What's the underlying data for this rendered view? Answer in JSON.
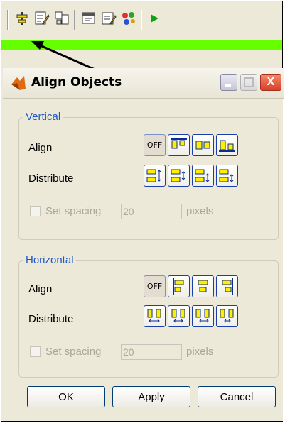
{
  "window": {
    "title": "Align Objects",
    "close_symbol": "X"
  },
  "toolbar": {
    "icons": [
      "align-icon",
      "edit-icon",
      "grid-icon",
      "report-icon",
      "page-edit-icon",
      "components-icon",
      "run-icon"
    ]
  },
  "vertical": {
    "title": "Vertical",
    "align_label": "Align",
    "distribute_label": "Distribute",
    "off_label": "OFF",
    "set_spacing_label": "Set spacing",
    "spacing_value": "20",
    "units_label": "pixels"
  },
  "horizontal": {
    "title": "Horizontal",
    "align_label": "Align",
    "distribute_label": "Distribute",
    "off_label": "OFF",
    "set_spacing_label": "Set spacing",
    "spacing_value": "20",
    "units_label": "pixels"
  },
  "buttons": {
    "ok": "OK",
    "apply": "Apply",
    "cancel": "Cancel"
  },
  "colors": {
    "highlight_bar": "#66ff00",
    "group_title": "#1f57c9",
    "icon_yellow": "#ffee00",
    "icon_blue": "#0a2d8f"
  }
}
